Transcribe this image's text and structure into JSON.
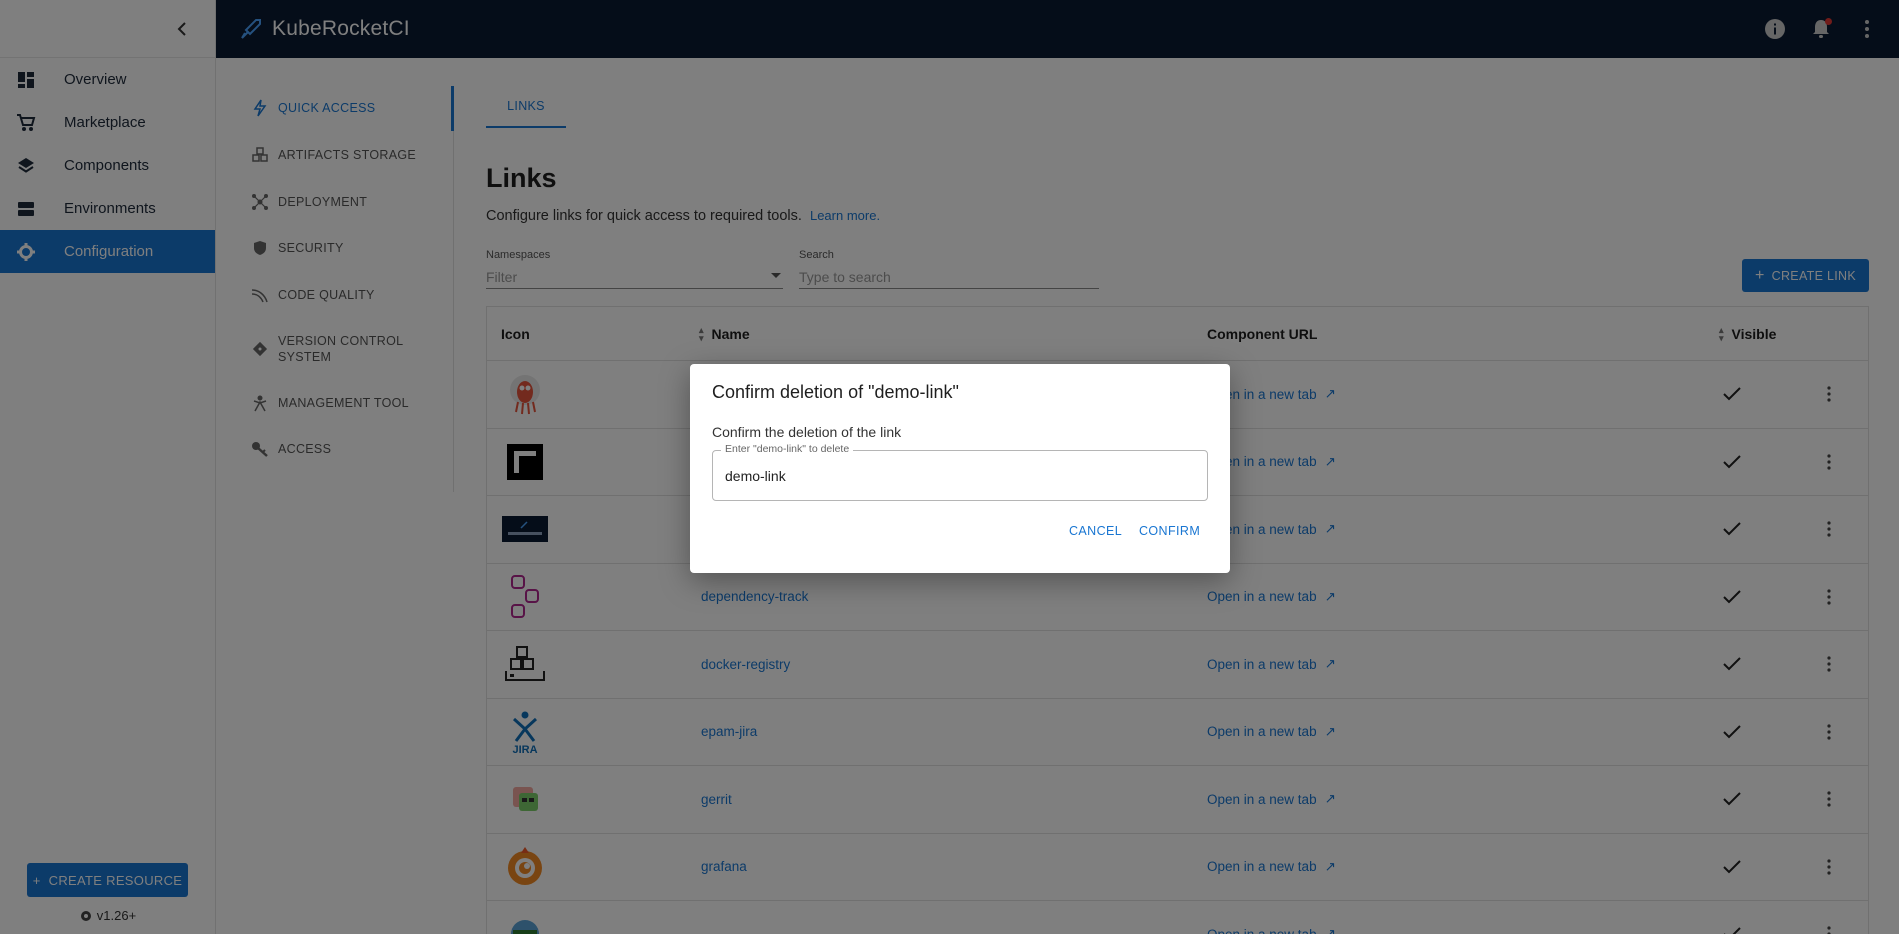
{
  "app": {
    "brand": "KubeRocketCI"
  },
  "sidebar": {
    "items": [
      {
        "label": "Overview",
        "icon": "dashboard-icon"
      },
      {
        "label": "Marketplace",
        "icon": "cart-icon"
      },
      {
        "label": "Components",
        "icon": "layers-icon"
      },
      {
        "label": "Environments",
        "icon": "servers-icon"
      },
      {
        "label": "Configuration",
        "icon": "gear-icon",
        "active": true
      }
    ],
    "create_resource": "CREATE RESOURCE",
    "version": "v1.26+"
  },
  "submenu": {
    "items": [
      {
        "label": "QUICK ACCESS",
        "active": true
      },
      {
        "label": "ARTIFACTS STORAGE"
      },
      {
        "label": "DEPLOYMENT"
      },
      {
        "label": "SECURITY"
      },
      {
        "label": "CODE QUALITY"
      },
      {
        "label": "VERSION CONTROL",
        "label2": "SYSTEM"
      },
      {
        "label": "MANAGEMENT TOOL"
      },
      {
        "label": "ACCESS"
      }
    ]
  },
  "main": {
    "tab": "LINKS",
    "title": "Links",
    "description": "Configure links for quick access to required tools.",
    "learn_more": "Learn more.",
    "namespaces": {
      "label": "Namespaces",
      "placeholder": "Filter"
    },
    "search": {
      "label": "Search",
      "placeholder": "Type to search"
    },
    "create_link": "CREATE LINK",
    "table": {
      "headers": {
        "icon": "Icon",
        "name": "Name",
        "url": "Component URL",
        "visible": "Visible"
      },
      "url_text": "Open in a new tab",
      "rows": [
        {
          "name": "",
          "icon": "argocd-icon"
        },
        {
          "name": "",
          "icon": "codemie-icon"
        },
        {
          "name": "",
          "icon": "kuberocketci-icon"
        },
        {
          "name": "dependency-track",
          "icon": "dependency-track-icon"
        },
        {
          "name": "docker-registry",
          "icon": "docker-registry-icon"
        },
        {
          "name": "epam-jira",
          "icon": "jira-icon"
        },
        {
          "name": "gerrit",
          "icon": "gerrit-icon"
        },
        {
          "name": "grafana",
          "icon": "grafana-icon"
        },
        {
          "name": "",
          "icon": "keycloak-icon"
        }
      ]
    }
  },
  "dialog": {
    "title": "Confirm deletion of \"demo-link\"",
    "text": "Confirm the deletion of the link",
    "field_label": "Enter \"demo-link\" to delete",
    "field_value": "demo-link",
    "cancel": "CANCEL",
    "confirm": "CONFIRM"
  },
  "colors": {
    "primary": "#1976d2",
    "topbar": "#0b1a33"
  }
}
